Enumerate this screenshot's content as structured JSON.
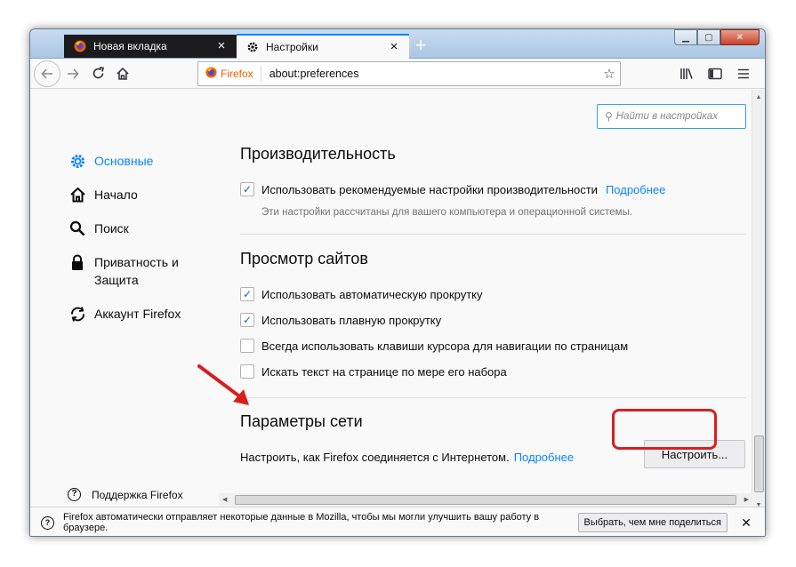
{
  "tabs": [
    {
      "title": "Новая вкладка",
      "icon": "firefox-icon"
    },
    {
      "title": "Настройки",
      "icon": "gear-icon"
    }
  ],
  "toolbar": {
    "url_identity": "Firefox",
    "url": "about:preferences"
  },
  "search": {
    "placeholder": "Найти в настройках"
  },
  "sidebar": {
    "items": [
      {
        "label": "Основные",
        "icon": "gear-icon",
        "selected": true
      },
      {
        "label": "Начало",
        "icon": "home-icon"
      },
      {
        "label": "Поиск",
        "icon": "search-icon"
      },
      {
        "label": "Приватность и Защита",
        "icon": "lock-icon"
      },
      {
        "label": "Аккаунт Firefox",
        "icon": "sync-icon"
      }
    ],
    "support": "Поддержка Firefox"
  },
  "performance": {
    "title": "Производительность",
    "recommended_label": "Использовать рекомендуемые настройки производительности",
    "recommended_checked": true,
    "learn_more": "Подробнее",
    "hint": "Эти настройки рассчитаны для вашего компьютера и операционной системы."
  },
  "browsing": {
    "title": "Просмотр сайтов",
    "options": [
      {
        "label": "Использовать автоматическую прокрутку",
        "checked": true
      },
      {
        "label": "Использовать плавную прокрутку",
        "checked": true
      },
      {
        "label": "Всегда использовать клавиши курсора для навигации по страницам",
        "checked": false
      },
      {
        "label": "Искать текст на странице по мере его набора",
        "checked": false
      }
    ]
  },
  "network": {
    "title": "Параметры сети",
    "description": "Настроить, как Firefox соединяется с Интернетом.",
    "learn_more": "Подробнее",
    "button": "Настроить..."
  },
  "notification": {
    "text": "Firefox автоматически отправляет некоторые данные в Mozilla, чтобы мы могли улучшить вашу работу в браузере.",
    "button": "Выбрать, чем мне поделиться"
  },
  "colors": {
    "accent": "#0a84ff",
    "annotation": "#d81f1f"
  }
}
